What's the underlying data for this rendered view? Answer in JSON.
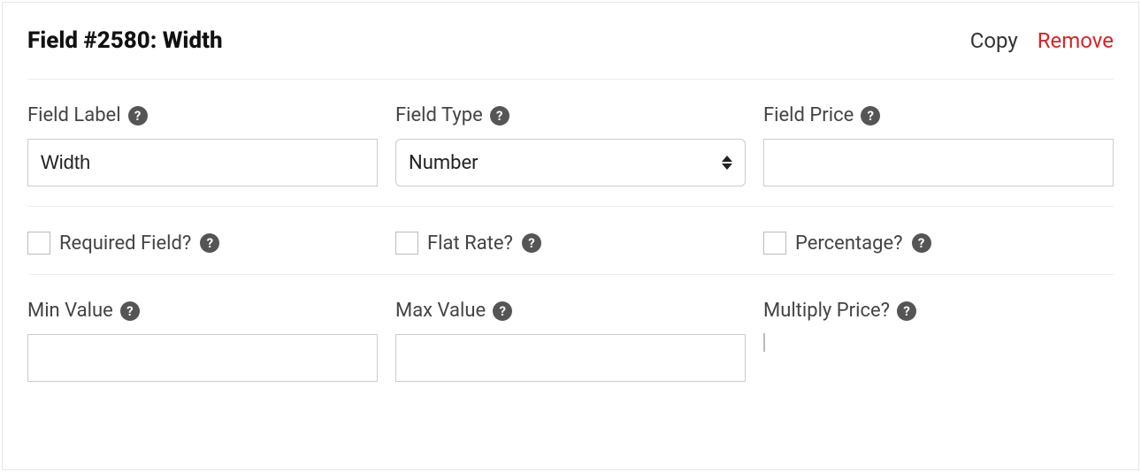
{
  "header": {
    "title": "Field #2580: Width",
    "copy": "Copy",
    "remove": "Remove"
  },
  "row1": {
    "fieldLabel": {
      "label": "Field Label",
      "value": "Width"
    },
    "fieldType": {
      "label": "Field Type",
      "value": "Number"
    },
    "fieldPrice": {
      "label": "Field Price",
      "value": ""
    }
  },
  "row2": {
    "required": {
      "label": "Required Field?"
    },
    "flatRate": {
      "label": "Flat Rate?"
    },
    "percentage": {
      "label": "Percentage?"
    }
  },
  "row3": {
    "minValue": {
      "label": "Min Value",
      "value": ""
    },
    "maxValue": {
      "label": "Max Value",
      "value": ""
    },
    "multiplyPrice": {
      "label": "Multiply Price?"
    }
  }
}
